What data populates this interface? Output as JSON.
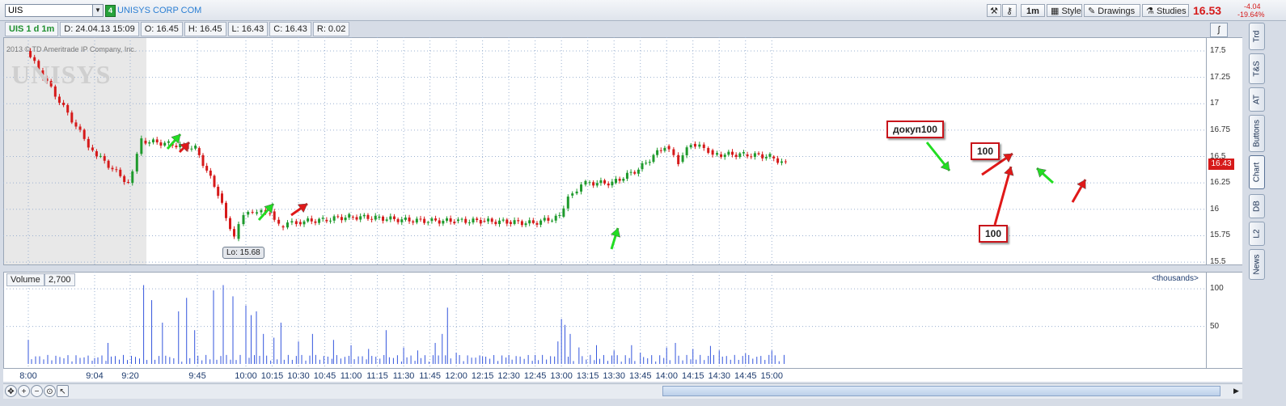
{
  "header": {
    "symbol": "UIS",
    "link_number": "4",
    "company": "UNISYS CORP COM",
    "timeframe_button": "1m",
    "style_button": "Style",
    "drawings_button": "Drawings",
    "studies_button": "Studies",
    "last_price": "16.53",
    "change": "-4.04",
    "change_pct": "-19.64%"
  },
  "infobar": {
    "study": "UIS 1 d 1m",
    "date": "D: 24.04.13 15:09",
    "open": "O: 16.45",
    "high": "H: 16.45",
    "low": "L: 16.43",
    "close": "C: 16.43",
    "range": "R: 0.02"
  },
  "chart_overlay": {
    "copyright": "2013 © TD Ameritrade IP Company, Inc.",
    "watermark": "UNISYS",
    "lo_label": "Lo: 15.68",
    "current_price": "16.43"
  },
  "annotations": {
    "dokup": "докуп100",
    "buy_a": "100",
    "buy_b": "100"
  },
  "volume_panel": {
    "label": "Volume",
    "value": "2,700",
    "units": "<thousands>"
  },
  "sidebar_tabs": [
    "Trd",
    "T&S",
    "AT",
    "Buttons",
    "Chart",
    "DB",
    "L2",
    "News"
  ],
  "colors": {
    "up": "#1e9a2c",
    "down": "#d61a1a",
    "volume": "#3355dd",
    "accent": "#2a7ed3",
    "arrow_green": "#22dd22",
    "arrow_red": "#e01818"
  },
  "chart_data": {
    "type": "candlestick",
    "price_axis": {
      "ticks": [
        "17.5",
        "17.25",
        "17",
        "16.75",
        "16.5",
        "16.25",
        "16",
        "15.75",
        "15.5"
      ],
      "range": [
        15.47,
        17.63
      ]
    },
    "volume_axis": {
      "ticks": [
        "100",
        "50"
      ],
      "range": [
        0,
        112
      ]
    },
    "time_ticks": [
      "8:00",
      "9:04",
      "9:20",
      "9:45",
      "10:00",
      "10:15",
      "10:30",
      "10:45",
      "11:00",
      "11:15",
      "11:30",
      "11:45",
      "12:00",
      "12:15",
      "12:30",
      "12:45",
      "13:00",
      "13:15",
      "13:30",
      "13:45",
      "14:00",
      "14:15",
      "14:30",
      "14:45",
      "15:00"
    ],
    "price_series": [
      {
        "t": "8:00",
        "p": 17.5
      },
      {
        "t": "9:04",
        "p": 16.55
      },
      {
        "t": "9:20",
        "p": 16.25
      },
      {
        "t": "9:25",
        "p": 16.65
      },
      {
        "t": "9:35",
        "p": 16.62
      },
      {
        "t": "9:45",
        "p": 16.58
      },
      {
        "t": "9:52",
        "p": 16.15
      },
      {
        "t": "9:57",
        "p": 15.72
      },
      {
        "t": "10:00",
        "p": 15.95
      },
      {
        "t": "10:05",
        "p": 15.96
      },
      {
        "t": "10:15",
        "p": 15.98
      },
      {
        "t": "10:20",
        "p": 15.84
      },
      {
        "t": "10:30",
        "p": 15.88
      },
      {
        "t": "10:45",
        "p": 15.9
      },
      {
        "t": "11:00",
        "p": 15.93
      },
      {
        "t": "11:15",
        "p": 15.92
      },
      {
        "t": "11:30",
        "p": 15.9
      },
      {
        "t": "11:45",
        "p": 15.89
      },
      {
        "t": "12:00",
        "p": 15.89
      },
      {
        "t": "12:15",
        "p": 15.89
      },
      {
        "t": "12:30",
        "p": 15.88
      },
      {
        "t": "12:45",
        "p": 15.87
      },
      {
        "t": "13:00",
        "p": 15.93
      },
      {
        "t": "13:05",
        "p": 16.13
      },
      {
        "t": "13:15",
        "p": 16.25
      },
      {
        "t": "13:30",
        "p": 16.25
      },
      {
        "t": "13:45",
        "p": 16.38
      },
      {
        "t": "14:00",
        "p": 16.6
      },
      {
        "t": "14:08",
        "p": 16.45
      },
      {
        "t": "14:15",
        "p": 16.62
      },
      {
        "t": "14:25",
        "p": 16.56
      },
      {
        "t": "14:30",
        "p": 16.52
      },
      {
        "t": "14:45",
        "p": 16.52
      },
      {
        "t": "15:00",
        "p": 16.5
      },
      {
        "t": "15:09",
        "p": 16.43
      }
    ],
    "volume_bars": [
      {
        "t": "8:00",
        "v": 32
      },
      {
        "t": "9:04",
        "v": 8
      },
      {
        "t": "9:10",
        "v": 28
      },
      {
        "t": "9:25",
        "v": 105
      },
      {
        "t": "9:28",
        "v": 85
      },
      {
        "t": "9:32",
        "v": 55
      },
      {
        "t": "9:38",
        "v": 70
      },
      {
        "t": "9:41",
        "v": 88
      },
      {
        "t": "9:44",
        "v": 45
      },
      {
        "t": "9:50",
        "v": 98
      },
      {
        "t": "9:53",
        "v": 105
      },
      {
        "t": "9:56",
        "v": 90
      },
      {
        "t": "10:00",
        "v": 78
      },
      {
        "t": "10:03",
        "v": 65
      },
      {
        "t": "10:06",
        "v": 70
      },
      {
        "t": "10:10",
        "v": 40
      },
      {
        "t": "10:16",
        "v": 35
      },
      {
        "t": "10:20",
        "v": 55
      },
      {
        "t": "10:30",
        "v": 30
      },
      {
        "t": "10:38",
        "v": 40
      },
      {
        "t": "10:50",
        "v": 32
      },
      {
        "t": "11:00",
        "v": 25
      },
      {
        "t": "11:10",
        "v": 20
      },
      {
        "t": "11:20",
        "v": 45
      },
      {
        "t": "11:30",
        "v": 22
      },
      {
        "t": "11:38",
        "v": 18
      },
      {
        "t": "11:48",
        "v": 28
      },
      {
        "t": "11:52",
        "v": 40
      },
      {
        "t": "11:55",
        "v": 75
      },
      {
        "t": "12:00",
        "v": 15
      },
      {
        "t": "12:15",
        "v": 10
      },
      {
        "t": "12:30",
        "v": 12
      },
      {
        "t": "12:45",
        "v": 12
      },
      {
        "t": "12:58",
        "v": 30
      },
      {
        "t": "13:00",
        "v": 60
      },
      {
        "t": "13:02",
        "v": 52
      },
      {
        "t": "13:05",
        "v": 40
      },
      {
        "t": "13:10",
        "v": 22
      },
      {
        "t": "13:20",
        "v": 25
      },
      {
        "t": "13:30",
        "v": 18
      },
      {
        "t": "13:40",
        "v": 25
      },
      {
        "t": "13:45",
        "v": 15
      },
      {
        "t": "14:00",
        "v": 22
      },
      {
        "t": "14:05",
        "v": 28
      },
      {
        "t": "14:15",
        "v": 20
      },
      {
        "t": "14:25",
        "v": 24
      },
      {
        "t": "14:30",
        "v": 18
      },
      {
        "t": "14:45",
        "v": 14
      },
      {
        "t": "15:00",
        "v": 18
      },
      {
        "t": "15:07",
        "v": 12
      }
    ]
  }
}
